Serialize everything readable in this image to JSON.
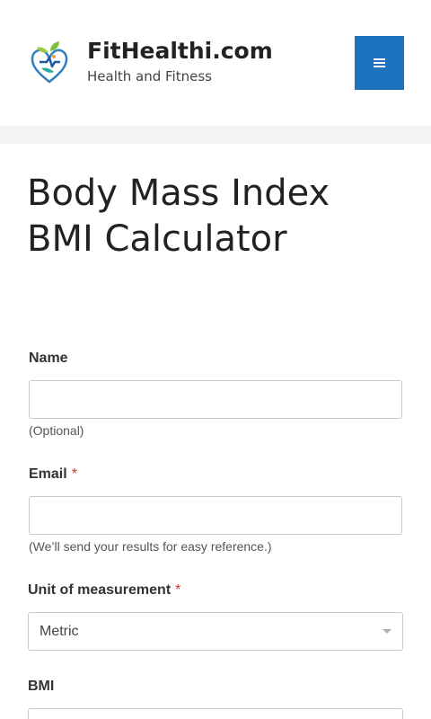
{
  "site": {
    "title": "FitHealthi.com",
    "description": "Health and Fitness",
    "logo_icon": "heart-leaf-logo-icon",
    "menu_icon": "hamburger-menu-icon",
    "accent_color": "#1e73be"
  },
  "page": {
    "title_line1": "Body Mass Index",
    "title_line2": "BMI Calculator"
  },
  "form": {
    "name": {
      "label": "Name",
      "value": "",
      "description": "(Optional)"
    },
    "email": {
      "label": "Email",
      "required_mark": "*",
      "value": "",
      "description": "(We’ll send your results for easy reference.)"
    },
    "unit": {
      "label": "Unit of measurement",
      "required_mark": "*",
      "selected": "Metric"
    },
    "bmi": {
      "label": "BMI"
    }
  }
}
